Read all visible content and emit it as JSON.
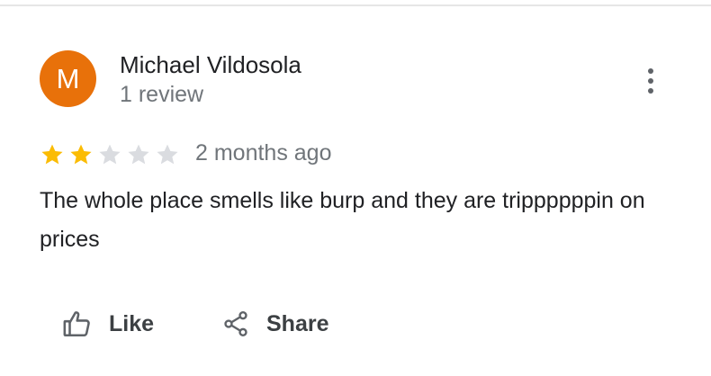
{
  "review": {
    "avatar_letter": "M",
    "avatar_color": "#e8710a",
    "reviewer_name": "Michael Vildosola",
    "review_count": "1 review",
    "rating": 2,
    "rating_max": 5,
    "star_filled_color": "#fbbc04",
    "star_empty_color": "#dadce0",
    "date": "2 months ago",
    "text": "The whole place smells like burp and they are trippppppin on prices",
    "more_icon": "more-vert-icon"
  },
  "actions": {
    "like_label": "Like",
    "like_icon": "thumbs-up-icon",
    "share_label": "Share",
    "share_icon": "share-icon"
  }
}
